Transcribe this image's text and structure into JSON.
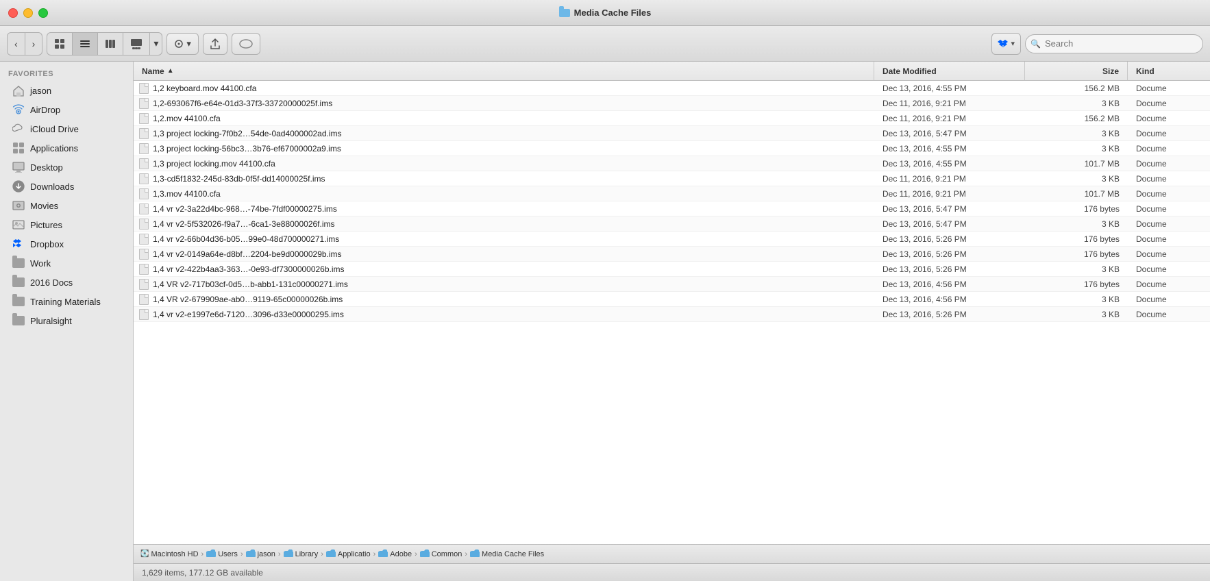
{
  "window": {
    "title": "Media Cache Files",
    "controls": {
      "close": "●",
      "minimize": "●",
      "maximize": "●"
    }
  },
  "toolbar": {
    "back_label": "‹",
    "forward_label": "›",
    "view_icons": "⊞",
    "view_list": "≡",
    "view_columns": "⋮",
    "view_gallery": "⊟",
    "view_dropdown": "▾",
    "action_label": "⚙",
    "share_label": "↑",
    "tag_label": "○",
    "dropbox_label": "✦",
    "search_placeholder": "Search"
  },
  "sidebar": {
    "favorites_header": "Favorites",
    "items": [
      {
        "id": "jason",
        "label": "jason",
        "icon": "home"
      },
      {
        "id": "airdrop",
        "label": "AirDrop",
        "icon": "airdrop"
      },
      {
        "id": "icloud",
        "label": "iCloud Drive",
        "icon": "cloud"
      },
      {
        "id": "applications",
        "label": "Applications",
        "icon": "apps"
      },
      {
        "id": "desktop",
        "label": "Desktop",
        "icon": "folder"
      },
      {
        "id": "downloads",
        "label": "Downloads",
        "icon": "downloads"
      },
      {
        "id": "movies",
        "label": "Movies",
        "icon": "movies"
      },
      {
        "id": "pictures",
        "label": "Pictures",
        "icon": "pictures"
      },
      {
        "id": "dropbox",
        "label": "Dropbox",
        "icon": "dropbox"
      },
      {
        "id": "work",
        "label": "Work",
        "icon": "folder"
      },
      {
        "id": "2016docs",
        "label": "2016 Docs",
        "icon": "folder"
      },
      {
        "id": "training",
        "label": "Training Materials",
        "icon": "folder"
      },
      {
        "id": "pluralsight",
        "label": "Pluralsight",
        "icon": "folder"
      }
    ]
  },
  "columns": {
    "name": "Name",
    "date": "Date Modified",
    "size": "Size",
    "kind": "Kind"
  },
  "files": [
    {
      "name": "1,2 keyboard.mov 44100.cfa",
      "date": "Dec 13, 2016, 4:55 PM",
      "size": "156.2 MB",
      "kind": "Docume"
    },
    {
      "name": "1,2-693067f6-e64e-01d3-37f3-33720000025f.ims",
      "date": "Dec 11, 2016, 9:21 PM",
      "size": "3 KB",
      "kind": "Docume"
    },
    {
      "name": "1,2.mov 44100.cfa",
      "date": "Dec 11, 2016, 9:21 PM",
      "size": "156.2 MB",
      "kind": "Docume"
    },
    {
      "name": "1,3 project locking-7f0b2…54de-0ad4000002ad.ims",
      "date": "Dec 13, 2016, 5:47 PM",
      "size": "3 KB",
      "kind": "Docume"
    },
    {
      "name": "1,3 project locking-56bc3…3b76-ef67000002a9.ims",
      "date": "Dec 13, 2016, 4:55 PM",
      "size": "3 KB",
      "kind": "Docume"
    },
    {
      "name": "1,3 project locking.mov 44100.cfa",
      "date": "Dec 13, 2016, 4:55 PM",
      "size": "101.7 MB",
      "kind": "Docume"
    },
    {
      "name": "1,3-cd5f1832-245d-83db-0f5f-dd14000025f.ims",
      "date": "Dec 11, 2016, 9:21 PM",
      "size": "3 KB",
      "kind": "Docume"
    },
    {
      "name": "1,3.mov 44100.cfa",
      "date": "Dec 11, 2016, 9:21 PM",
      "size": "101.7 MB",
      "kind": "Docume"
    },
    {
      "name": "1,4 vr v2-3a22d4bc-968…-74be-7fdf00000275.ims",
      "date": "Dec 13, 2016, 5:47 PM",
      "size": "176 bytes",
      "kind": "Docume"
    },
    {
      "name": "1,4 vr v2-5f532026-f9a7…-6ca1-3e88000026f.ims",
      "date": "Dec 13, 2016, 5:47 PM",
      "size": "3 KB",
      "kind": "Docume"
    },
    {
      "name": "1,4 vr v2-66b04d36-b05…99e0-48d700000271.ims",
      "date": "Dec 13, 2016, 5:26 PM",
      "size": "176 bytes",
      "kind": "Docume"
    },
    {
      "name": "1,4 vr v2-0149a64e-d8bf…2204-be9d0000029b.ims",
      "date": "Dec 13, 2016, 5:26 PM",
      "size": "176 bytes",
      "kind": "Docume"
    },
    {
      "name": "1,4 vr v2-422b4aa3-363…-0e93-df7300000026b.ims",
      "date": "Dec 13, 2016, 5:26 PM",
      "size": "3 KB",
      "kind": "Docume"
    },
    {
      "name": "1,4 VR v2-717b03cf-0d5…b-abb1-131c00000271.ims",
      "date": "Dec 13, 2016, 4:56 PM",
      "size": "176 bytes",
      "kind": "Docume"
    },
    {
      "name": "1,4 VR v2-679909ae-ab0…9119-65c00000026b.ims",
      "date": "Dec 13, 2016, 4:56 PM",
      "size": "3 KB",
      "kind": "Docume"
    },
    {
      "name": "1,4 vr v2-e1997e6d-7120…3096-d33e00000295.ims",
      "date": "Dec 13, 2016, 5:26 PM",
      "size": "3 KB",
      "kind": "Docume"
    }
  ],
  "path": [
    {
      "label": "Macintosh HD",
      "type": "hd"
    },
    {
      "label": "Users",
      "type": "blue"
    },
    {
      "label": "jason",
      "type": "blue"
    },
    {
      "label": "Library",
      "type": "blue"
    },
    {
      "label": "Applicatio",
      "type": "blue"
    },
    {
      "label": "Adobe",
      "type": "blue"
    },
    {
      "label": "Common",
      "type": "blue"
    },
    {
      "label": "Media Cache Files",
      "type": "blue"
    }
  ],
  "status": "1,629 items, 177.12 GB available"
}
